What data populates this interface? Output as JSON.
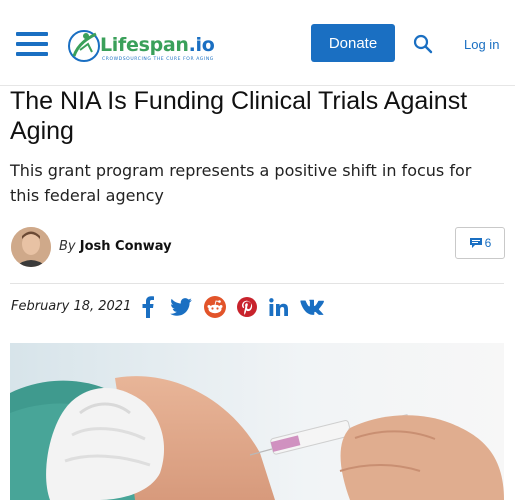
{
  "header": {
    "logo": {
      "name": "Lifespan",
      "tld": ".io",
      "tagline": "CROWDSOURCING THE CURE FOR AGING"
    },
    "donate_label": "Donate",
    "login_label": "Log in"
  },
  "article": {
    "title": "The NIA Is Funding Clinical Trials Against Aging",
    "subtitle": "This grant program represents a positive shift in focus for this federal agency",
    "by_label": "By",
    "author": "Josh Conway",
    "comment_count": "6",
    "date": "February 18, 2021"
  },
  "share_icons": [
    "facebook-icon",
    "twitter-icon",
    "reddit-icon",
    "pinterest-icon",
    "linkedin-icon",
    "vk-icon"
  ],
  "colors": {
    "accent": "#1a6fc2",
    "logo_green": "#3aa05a",
    "reddit": "#e2542a",
    "pinterest": "#c8232c"
  }
}
